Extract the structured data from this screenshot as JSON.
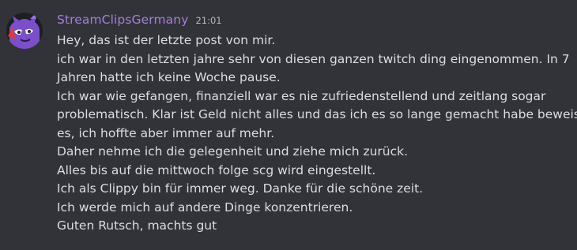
{
  "message": {
    "author": "StreamClipsGermany",
    "author_color": "#a77de0",
    "timestamp": "21:01",
    "lines": [
      "Hey, das ist der letzte post von mir.",
      "ich war in den letzten jahre sehr von diesen ganzen twitch ding eingenommen. In 7",
      "Jahren hatte ich keine Woche pause.",
      "Ich war wie gefangen, finanziell war es nie zufriedenstellend und zeitlang sogar",
      "problematisch. Klar ist Geld nicht alles und das ich es so lange gemacht habe beweist",
      "es, ich hoffte aber immer auf mehr.",
      "Daher nehme ich die gelegenheit und ziehe mich zurück.",
      "Alles bis auf die mittwoch folge scg wird eingestellt.",
      "Ich als Clippy bin für immer weg. Danke für die schöne zeit.",
      "Ich werde mich auf andere Dinge konzentrieren.",
      "Guten Rutsch, machts gut"
    ]
  },
  "avatar": {
    "icon": "purple-cartoon-character-avatar",
    "colors": {
      "background": "#1e1f22",
      "primary": "#7b4fc9",
      "accent": "#e03a3a"
    }
  }
}
